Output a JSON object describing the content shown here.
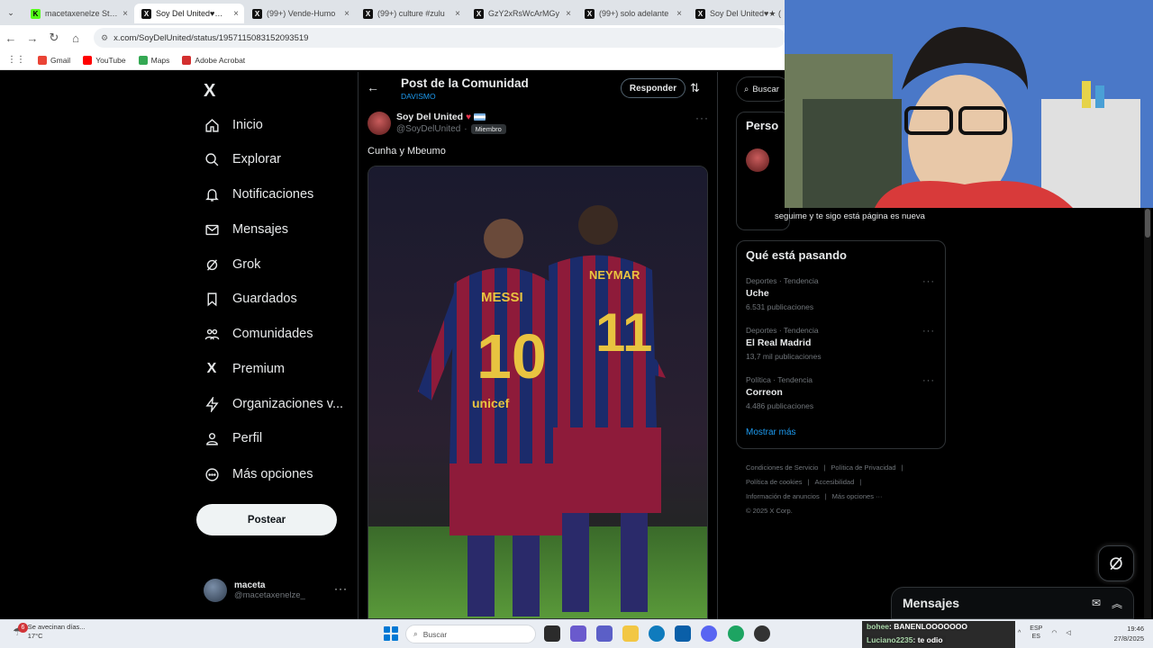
{
  "browser": {
    "tabs": [
      {
        "title": "macetaxenelze Strea",
        "favicon": "kick"
      },
      {
        "title": "Soy Del United♥★ en",
        "favicon": "x",
        "active": true
      },
      {
        "title": "(99+) Vende-Humo",
        "favicon": "x"
      },
      {
        "title": "(99+) culture #zulu",
        "favicon": "x"
      },
      {
        "title": "GzY2xRsWcArMGy",
        "favicon": "x"
      },
      {
        "title": "(99+) solo adelante",
        "favicon": "x"
      },
      {
        "title": "Soy Del United♥★ (",
        "favicon": "x"
      }
    ],
    "url": "x.com/SoyDelUnited/status/1957115083152093519",
    "bookmarks": [
      {
        "label": "Gmail",
        "color": "#ea4335"
      },
      {
        "label": "YouTube",
        "color": "#ff0000"
      },
      {
        "label": "Maps",
        "color": "#34a853"
      },
      {
        "label": "Adobe Acrobat",
        "color": "#d32f2f"
      }
    ]
  },
  "sidebar": {
    "logo": "X",
    "items": [
      {
        "label": "Inicio",
        "icon": "home-icon"
      },
      {
        "label": "Explorar",
        "icon": "search-icon"
      },
      {
        "label": "Notificaciones",
        "icon": "bell-icon"
      },
      {
        "label": "Mensajes",
        "icon": "envelope-icon"
      },
      {
        "label": "Grok",
        "icon": "grok-icon"
      },
      {
        "label": "Guardados",
        "icon": "bookmark-icon"
      },
      {
        "label": "Comunidades",
        "icon": "people-icon"
      },
      {
        "label": "Premium",
        "icon": "x-icon"
      },
      {
        "label": "Organizaciones v...",
        "icon": "lightning-icon"
      },
      {
        "label": "Perfil",
        "icon": "person-icon"
      },
      {
        "label": "Más opciones",
        "icon": "more-circle-icon"
      }
    ],
    "post_button": "Postear",
    "account": {
      "name": "maceta",
      "handle": "@macetaxenelze_",
      "more": "···"
    }
  },
  "post": {
    "header_title": "Post de la Comunidad",
    "header_subtitle": "DAVISMO",
    "reply_button": "Responder",
    "author_name": "Soy Del United",
    "author_handle": "@SoyDelUnited",
    "separator": "·",
    "member_badge": "Miembro",
    "text": "Cunha y Mbeumo",
    "image": {
      "jersey_left_name": "MESSI",
      "jersey_left_number": "10",
      "jersey_right_name": "NEYMAR",
      "jersey_right_number": "11",
      "sponsor": "unicef"
    }
  },
  "right": {
    "search_placeholder": "Buscar",
    "people_title": "Perso",
    "people_bio": "seguime y te sigo está página es nueva",
    "trends_title": "Qué está pasando",
    "trends": [
      {
        "context": "Deportes · Tendencia",
        "name": "Uche",
        "count": "6.531 publicaciones"
      },
      {
        "context": "Deportes · Tendencia",
        "name": "El Real Madrid",
        "count": "13,7 mil publicaciones"
      },
      {
        "context": "Política · Tendencia",
        "name": "Correon",
        "count": "4.486 publicaciones"
      }
    ],
    "show_more": "Mostrar más",
    "footer": [
      "Condiciones de Servicio",
      "|",
      "Política de Privacidad",
      "|",
      "Política de cookies",
      "|",
      "Accesibilidad",
      "|",
      "Información de anuncios",
      "|",
      "Más opciones ···",
      "© 2025 X Corp."
    ]
  },
  "messages_drawer": {
    "title": "Mensajes"
  },
  "taskbar": {
    "weather_badge": "6",
    "weather_line1": "Se avecinan días...",
    "weather_line2": "17°C",
    "search_placeholder": "Buscar",
    "chat": [
      {
        "user": "bohee",
        "text": "BANENLOOOOOOO"
      },
      {
        "user": "Luciano2235",
        "text": "te odio"
      }
    ],
    "lang": "ESP",
    "lang2": "ES",
    "time": "19:46",
    "date": "27/8/2025"
  }
}
